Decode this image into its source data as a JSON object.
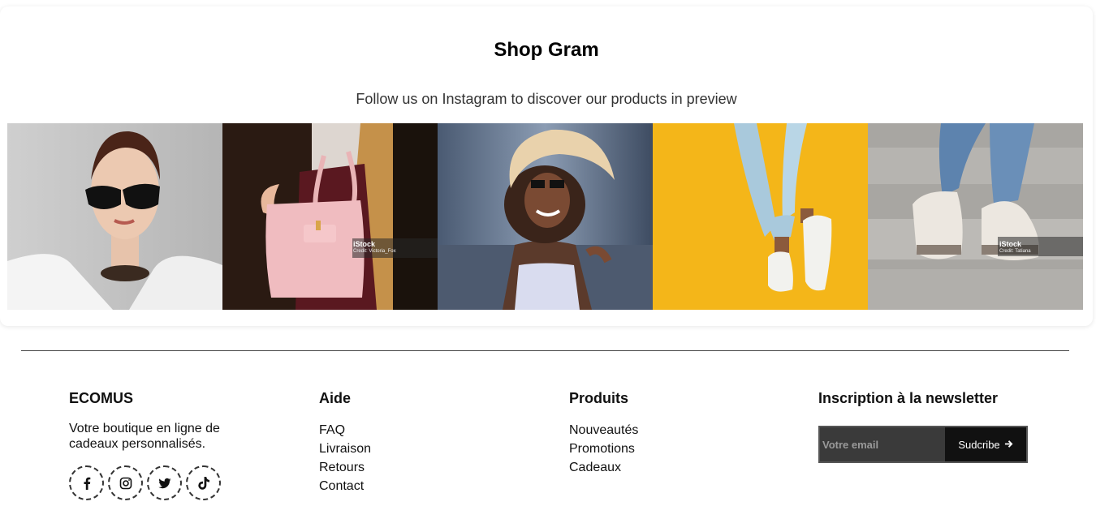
{
  "shop_gram": {
    "title": "Shop Gram",
    "subtitle": "Follow us on Instagram to discover our products in preview",
    "tiles": [
      {
        "name": "sunglasses-portrait",
        "watermark": ""
      },
      {
        "name": "pink-handbag",
        "watermark": "iStock",
        "credit": "Credit: Victoria_Fox"
      },
      {
        "name": "sun-hat-woman",
        "watermark": ""
      },
      {
        "name": "sneakers-yellow",
        "watermark": ""
      },
      {
        "name": "sneakers-stairs",
        "watermark": "iStock",
        "credit": "Credit: Tatiana"
      }
    ]
  },
  "footer": {
    "brand": {
      "title": "ECOMUS",
      "description": "Votre boutique en ligne de cadeaux personnalisés.",
      "socials": [
        "facebook-icon",
        "instagram-icon",
        "twitter-icon",
        "tiktok-icon"
      ]
    },
    "aide": {
      "title": "Aide",
      "links": [
        "FAQ",
        "Livraison",
        "Retours",
        "Contact"
      ]
    },
    "produits": {
      "title": "Produits",
      "links": [
        "Nouveautés",
        "Promotions",
        "Cadeaux"
      ]
    },
    "newsletter": {
      "title": "Inscription à la newsletter",
      "placeholder": "Votre email",
      "button_label": "Sudcribe"
    }
  },
  "colors": {
    "text": "#111111",
    "input_bg": "#3a3a3a",
    "button_bg": "#111111",
    "yellow": "#f4b619"
  }
}
